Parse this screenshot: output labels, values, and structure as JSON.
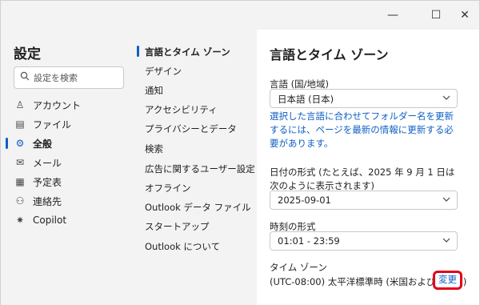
{
  "window": {
    "minimize_glyph": "—",
    "maximize_glyph": "☐",
    "close_glyph": "✕"
  },
  "left_nav": {
    "title": "設定",
    "search_placeholder": "設定を検索",
    "items": [
      {
        "label": "アカウント",
        "icon": "person-icon",
        "glyph": "♙"
      },
      {
        "label": "ファイル",
        "icon": "file-icon",
        "glyph": "▤"
      },
      {
        "label": "全般",
        "icon": "gear-icon",
        "glyph": "⚙",
        "active": true
      },
      {
        "label": "メール",
        "icon": "mail-icon",
        "glyph": "✉"
      },
      {
        "label": "予定表",
        "icon": "calendar-icon",
        "glyph": "▦"
      },
      {
        "label": "連絡先",
        "icon": "contacts-icon",
        "glyph": "⚇"
      },
      {
        "label": "Copilot",
        "icon": "copilot-icon",
        "glyph": "✷"
      }
    ]
  },
  "sub_nav": {
    "items": [
      "言語とタイム ゾーン",
      "デザイン",
      "通知",
      "アクセシビリティ",
      "プライバシーとデータ",
      "検索",
      "広告に関するユーザー設定",
      "オフライン",
      "Outlook データ ファイル",
      "スタートアップ",
      "Outlook について"
    ]
  },
  "content": {
    "title": "言語とタイム ゾーン",
    "language_label": "言語 (国/地域)",
    "language_value": "日本語 (日本)",
    "language_note": "選択した言語に合わせてフォルダー名を更新するには、ページを最新の情報に更新する必要があります。",
    "date_format_label": "日付の形式 (たとえば、2025 年 9 月 1 日は次のように表示されます)",
    "date_format_value": "2025-09-01",
    "time_format_label": "時刻の形式",
    "time_format_value": "01:01 - 23:59",
    "timezone_label": "タイム ゾーン",
    "timezone_value": "(UTC-08:00) 太平洋標準時 (米国およびカナダ)",
    "timezone_change": "変更"
  },
  "colors": {
    "accent": "#0f5fc4",
    "highlight": "#e3001b"
  }
}
